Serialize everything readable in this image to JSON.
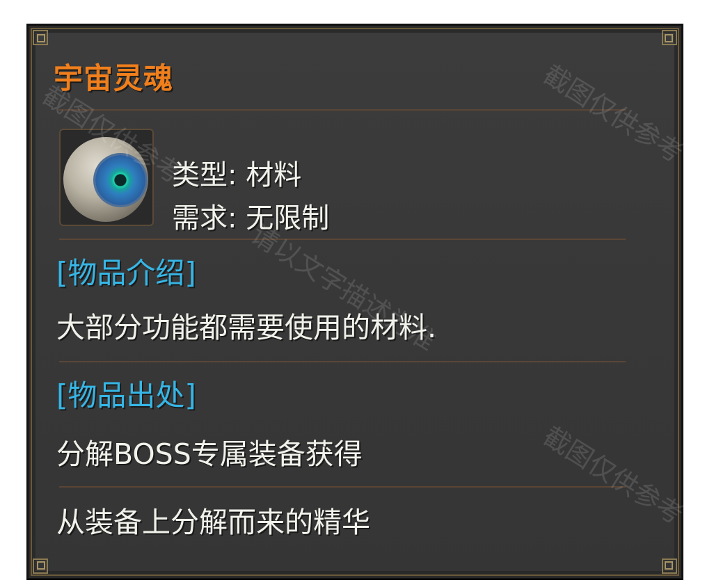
{
  "item": {
    "name": "宇宙灵魂",
    "icon": "eye-orb-icon",
    "type_label": "类型:",
    "type_value": "材料",
    "require_label": "需求:",
    "require_value": "无限制"
  },
  "sections": [
    {
      "heading": "[物品介绍]",
      "lines": [
        "大部分功能都需要使用的材料."
      ]
    },
    {
      "heading": "[物品出处]",
      "lines": [
        "分解BOSS专属装备获得",
        "从装备上分解而来的精华"
      ]
    }
  ],
  "watermarks": [
    "截图仅供参考",
    "请以文字描述为准",
    "截图仅供参考",
    "截图仅供参考"
  ],
  "colors": {
    "title": "#f07f1c",
    "section_heading": "#36b6e6",
    "text": "#f2f2ec",
    "panel_bg": "#3a3a3a",
    "border_gold": "#8a7a52"
  }
}
